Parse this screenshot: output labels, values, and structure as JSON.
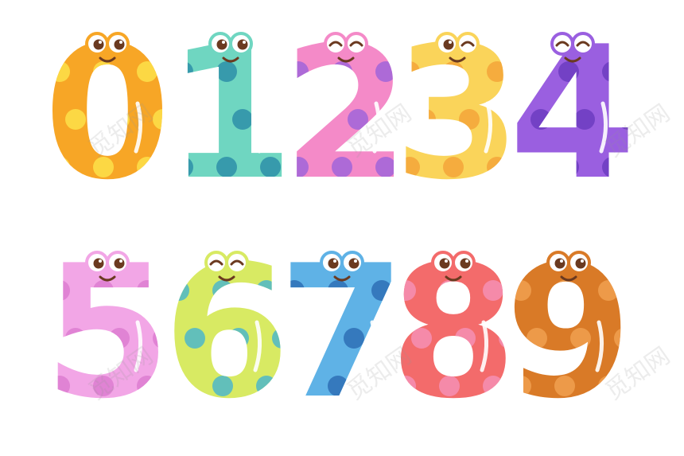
{
  "digits": [
    {
      "char": "0",
      "color": "#F7A626",
      "spot": "#FDE14A",
      "eyes": "open",
      "name": "digit-zero"
    },
    {
      "char": "1",
      "color": "#6FD6C1",
      "spot": "#2E8FA8",
      "eyes": "open",
      "name": "digit-one"
    },
    {
      "char": "2",
      "color": "#F48AC8",
      "spot": "#A064D9",
      "eyes": "closed",
      "name": "digit-two"
    },
    {
      "char": "3",
      "color": "#FAD45A",
      "spot": "#F3A43A",
      "eyes": "wink",
      "name": "digit-three"
    },
    {
      "char": "4",
      "color": "#9A5FE0",
      "spot": "#6C3CC0",
      "eyes": "closed",
      "name": "digit-four"
    },
    {
      "char": "5",
      "color": "#F2A6E6",
      "spot": "#DD7CD0",
      "eyes": "open",
      "name": "digit-five"
    },
    {
      "char": "6",
      "color": "#D8EA63",
      "spot": "#4DB7C9",
      "eyes": "closed",
      "name": "digit-six"
    },
    {
      "char": "7",
      "color": "#5FB2E6",
      "spot": "#2E6FB5",
      "eyes": "open",
      "name": "digit-seven"
    },
    {
      "char": "8",
      "color": "#F36B6B",
      "spot": "#F58FB4",
      "eyes": "open",
      "name": "digit-eight"
    },
    {
      "char": "9",
      "color": "#D97A27",
      "spot": "#F0A050",
      "eyes": "open",
      "name": "digit-nine"
    }
  ],
  "watermark": "觅知网"
}
